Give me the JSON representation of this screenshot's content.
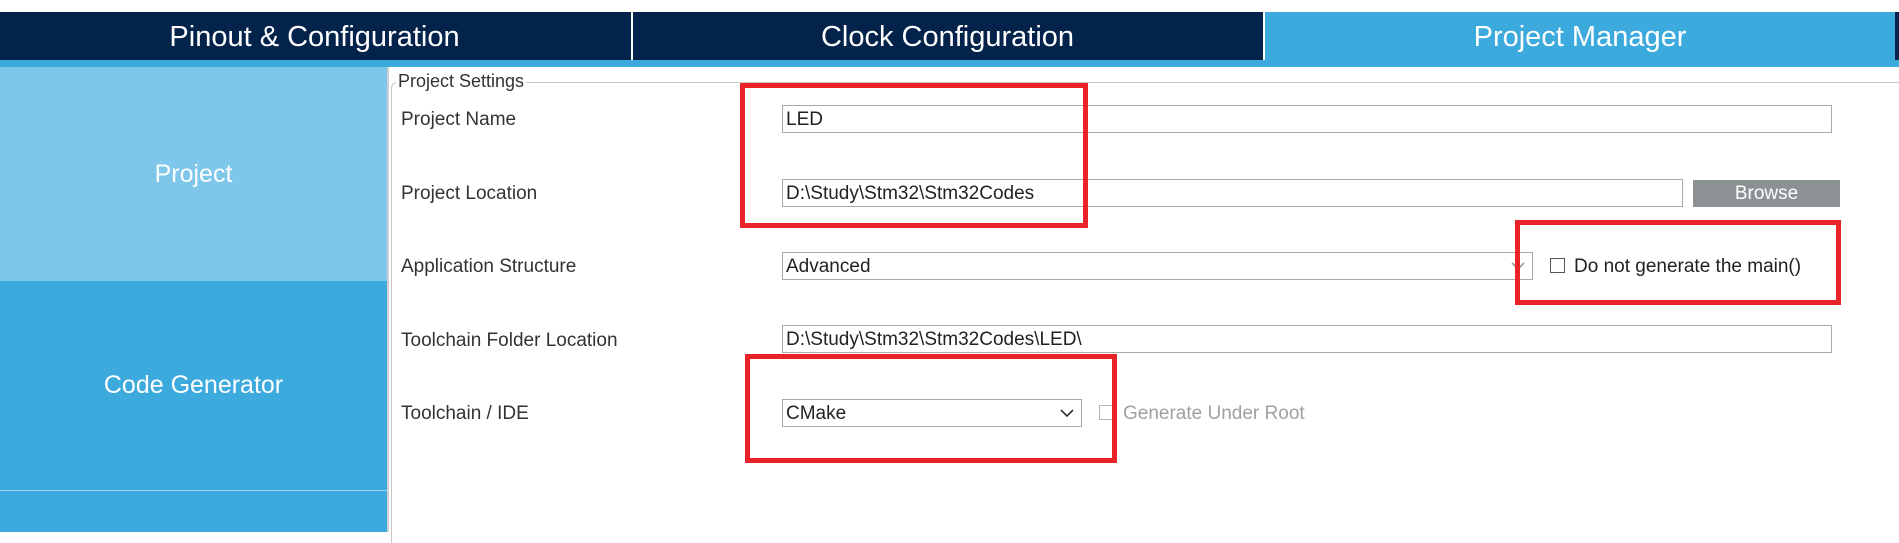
{
  "tabs": [
    {
      "label": "Pinout & Configuration",
      "active": false
    },
    {
      "label": "Clock Configuration",
      "active": false
    },
    {
      "label": "Project Manager",
      "active": true
    }
  ],
  "sidebar": {
    "items": [
      {
        "label": "Project",
        "selected": true
      },
      {
        "label": "Code Generator",
        "selected": false
      }
    ]
  },
  "project_settings": {
    "legend": "Project Settings",
    "project_name": {
      "label": "Project Name",
      "value": "LED"
    },
    "project_location": {
      "label": "Project Location",
      "value": "D:\\Study\\Stm32\\Stm32Codes",
      "browse_label": "Browse"
    },
    "application_structure": {
      "label": "Application Structure",
      "value": "Advanced",
      "checkbox_label": "Do not generate the main()",
      "checked": false
    },
    "toolchain_folder": {
      "label": "Toolchain Folder Location",
      "value": "D:\\Study\\Stm32\\Stm32Codes\\LED\\"
    },
    "toolchain_ide": {
      "label": "Toolchain / IDE",
      "value": "CMake",
      "checkbox_label": "Generate Under Root",
      "checked": false,
      "checkbox_enabled": false
    }
  },
  "icons": {
    "dropdown": "chevron-down-icon",
    "checkbox": "checkbox-icon"
  },
  "colors": {
    "tab_bar": "#03234b",
    "tab_active": "#3caadd",
    "sidebar_selected": "#7ec7ea",
    "sidebar": "#3caadd",
    "highlight": "#e8232a",
    "browse_button": "#8c9194"
  }
}
